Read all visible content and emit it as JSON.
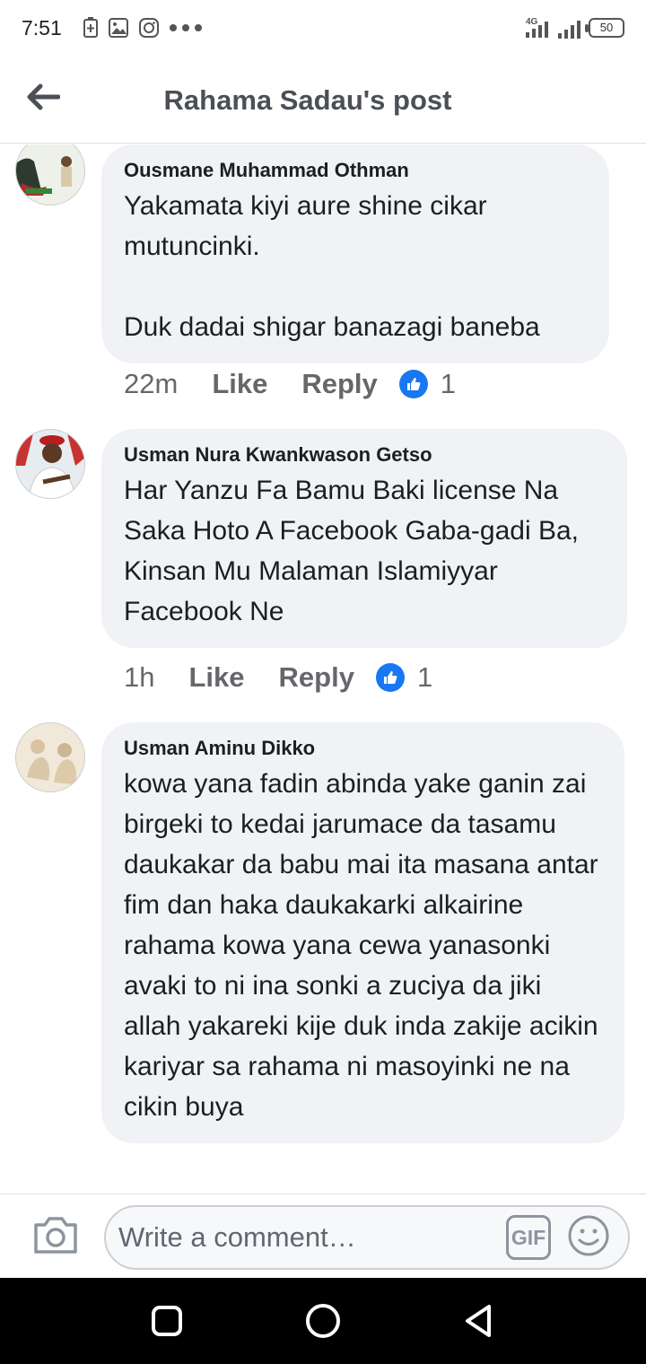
{
  "status_bar": {
    "time": "7:51",
    "left_icons": [
      "battery-saver-icon",
      "gallery-icon",
      "instagram-icon",
      "more-dots-icon"
    ],
    "network": "4G",
    "battery": "50"
  },
  "header": {
    "title": "Rahama Sadau's post",
    "back_icon": "back-arrow-icon"
  },
  "comments": [
    {
      "author": "Ousmane Muhammad Othman",
      "text": "Yakamata kiyi aure shine cikar mutuncinki.\n\nDuk dadai shigar banazagi baneba",
      "time": "22m",
      "like_label": "Like",
      "reply_label": "Reply",
      "reactions": "1"
    },
    {
      "author": "Usman Nura Kwankwason Getso",
      "text": "Har Yanzu Fa Bamu Baki license Na Saka Hoto A Facebook Gaba-gadi Ba, Kinsan Mu Malaman Islamiyyar Facebook Ne",
      "time": "1h",
      "like_label": "Like",
      "reply_label": "Reply",
      "reactions": "1"
    },
    {
      "author": "Usman Aminu Dikko",
      "text": "kowa yana fadin abinda yake ganin zai birgeki to kedai jarumace da tasamu daukakar da babu mai ita masana antar fim dan haka daukakarki alkairine rahama kowa yana cewa yanasonki avaki to ni ina sonki a zuciya da jiki allah yakareki kije duk inda zakije acikin kariyar sa rahama ni masoyinki ne na cikin buya"
    }
  ],
  "composer": {
    "placeholder": "Write a comment…",
    "gif_label": "GIF",
    "camera_icon": "camera-icon",
    "emoji_icon": "emoji-icon"
  },
  "nav_bar": {
    "icons": [
      "recents-square-icon",
      "home-circle-icon",
      "back-triangle-icon"
    ]
  },
  "colors": {
    "bubble": "#f0f2f5",
    "like_blue": "#1877f2",
    "header_text": "#4b4f56",
    "meta_text": "#65676b"
  }
}
